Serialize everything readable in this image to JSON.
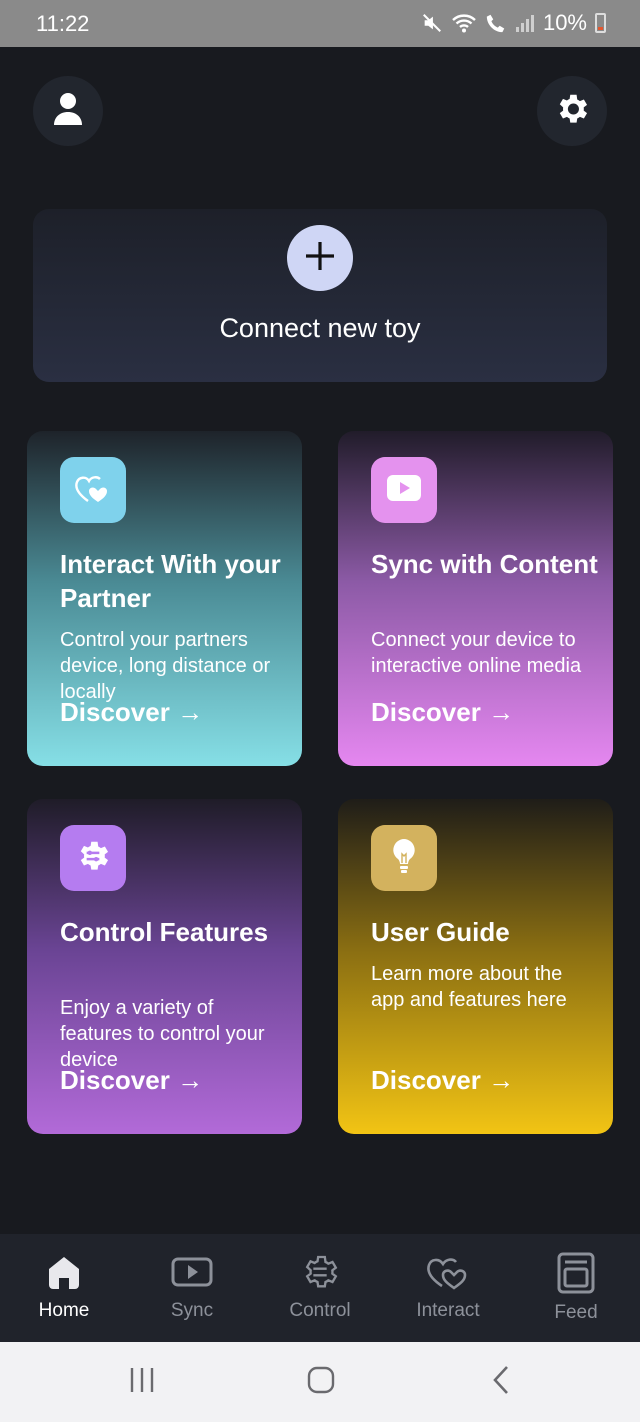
{
  "status_bar": {
    "time": "11:22",
    "battery": "10%",
    "icons": [
      "mute-icon",
      "wifi-icon",
      "wifi-call-icon",
      "signal-icon",
      "battery-icon"
    ]
  },
  "header": {
    "profile_icon": "person-icon",
    "settings_icon": "gear-icon"
  },
  "connect": {
    "label": "Connect new toy",
    "icon": "plus-icon"
  },
  "cards": [
    {
      "title": "Interact With your Partner",
      "description": "Control your partners device, long distance or locally",
      "discover": "Discover →",
      "icon": "hearts-icon",
      "icon_bg": "#7fd2ec"
    },
    {
      "title": "Sync with Content",
      "description": "Connect your device to interactive online media",
      "discover": "Discover →",
      "icon": "play-icon",
      "icon_bg": "#e492ee"
    },
    {
      "title": "Control Features",
      "description": "Enjoy a variety of features to control your device",
      "discover": "Discover →",
      "icon": "chip-icon",
      "icon_bg": "#b57cf0"
    },
    {
      "title": "User Guide",
      "description": "Learn more about the app and features here",
      "discover": "Discover →",
      "icon": "lightbulb-icon",
      "icon_bg": "#d3b25e"
    }
  ],
  "bottom_nav": [
    {
      "label": "Home",
      "icon": "home-icon",
      "active": true
    },
    {
      "label": "Sync",
      "icon": "play-icon",
      "active": false
    },
    {
      "label": "Control",
      "icon": "gear-sliders-icon",
      "active": false
    },
    {
      "label": "Interact",
      "icon": "hearts-icon",
      "active": false
    },
    {
      "label": "Feed",
      "icon": "feed-icon",
      "active": false
    }
  ],
  "system_nav": [
    "recents-icon",
    "home-circle-icon",
    "back-icon"
  ]
}
